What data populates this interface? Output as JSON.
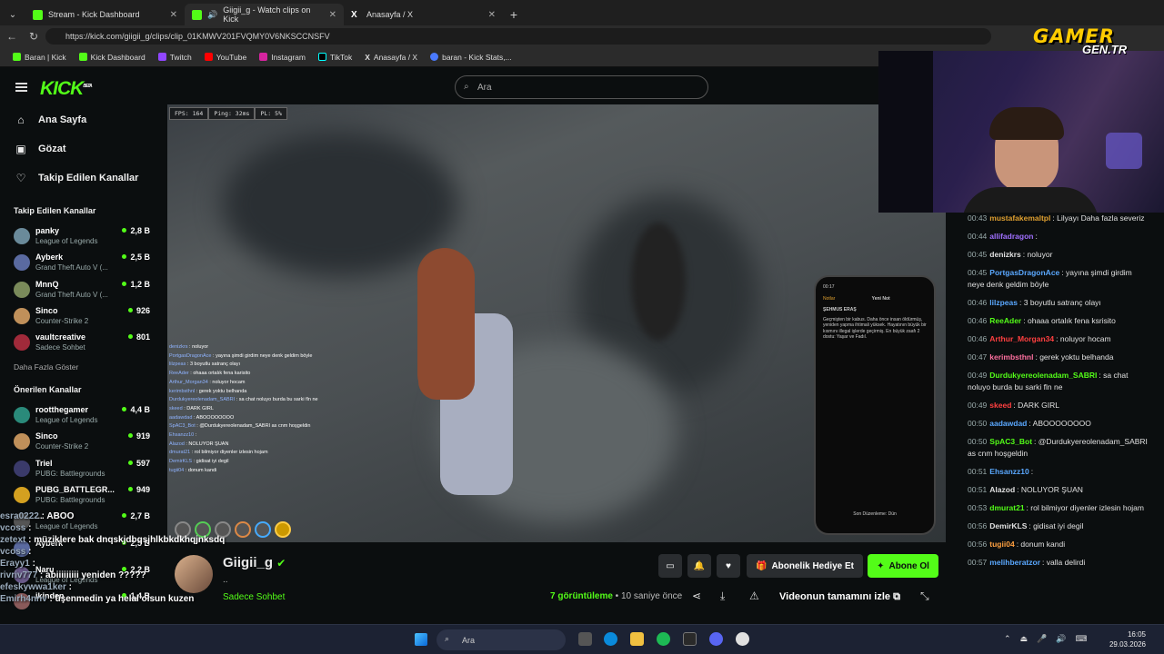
{
  "browser": {
    "tabs": [
      {
        "label": "Stream - Kick Dashboard",
        "color": "#53fc18"
      },
      {
        "label": "Giigii_g - Watch clips on Kick",
        "color": "#53fc18"
      },
      {
        "label": "Anasayfa / X",
        "color": "#ffffff"
      }
    ],
    "url": "https://kick.com/giigii_g/clips/clip_01KMWV201FVQMY0V6NKSCCNSFV",
    "bookmarks": [
      "Baran | Kick",
      "Kick Dashboard",
      "Twitch",
      "YouTube",
      "Instagram",
      "TikTok",
      "Anasayfa / X",
      "baran - Kick Stats,..."
    ]
  },
  "kick": {
    "logo": "KICK",
    "beta": "BETA",
    "nav": [
      "Ana Sayfa",
      "Gözat",
      "Takip Edilen Kanallar"
    ],
    "followed_title": "Takip Edilen Kanallar",
    "followed": [
      {
        "name": "panky",
        "game": "League of Legends",
        "viewers": "2,8 B",
        "color": "#6a8a9a"
      },
      {
        "name": "Ayberk",
        "game": "Grand Theft Auto V (...",
        "viewers": "2,5 B",
        "color": "#5a6aa0"
      },
      {
        "name": "MnnQ",
        "game": "Grand Theft Auto V (...",
        "viewers": "1,2 B",
        "color": "#7a8a5a"
      },
      {
        "name": "Sinco",
        "game": "Counter-Strike 2",
        "viewers": "926",
        "color": "#c0905a"
      },
      {
        "name": "vaultcreative",
        "game": "Sadece Sohbet",
        "viewers": "801",
        "color": "#a02a3a"
      }
    ],
    "show_more": "Daha Fazla Göster",
    "recommended_title": "Önerilen Kanallar",
    "recommended": [
      {
        "name": "rootthegamer",
        "game": "League of Legends",
        "viewers": "4,4 B",
        "color": "#2a8a7a"
      },
      {
        "name": "Sinco",
        "game": "Counter-Strike 2",
        "viewers": "919",
        "color": "#c0905a"
      },
      {
        "name": "Triel",
        "game": "PUBG: Battlegrounds",
        "viewers": "597",
        "color": "#3a3a6a"
      },
      {
        "name": "PUBG_BATTLEGR...",
        "game": "PUBG: Battlegrounds",
        "viewers": "949",
        "color": "#d4a020"
      },
      {
        "name": "...",
        "game": "League of Legends",
        "viewers": "2,7 B",
        "color": "#555"
      },
      {
        "name": "Ayberk",
        "game": "",
        "viewers": "2,5 B",
        "color": "#5a6aa0"
      },
      {
        "name": "Naru",
        "game": "League of Legends",
        "viewers": "2,2 B",
        "color": "#6a5a8a"
      },
      {
        "name": "ikinden",
        "game": "",
        "viewers": "1,4 B",
        "color": "#8a5a5a"
      }
    ],
    "search_placeholder": "Ara",
    "channel": {
      "name": "Giigii_g",
      "dots": "..",
      "category": "Sadece Sohbet",
      "views_count": "7",
      "views_label": "görüntüleme",
      "age": "10 saniye önce",
      "gift": "Abonelik Hediye Et",
      "subscribe": "Abone Ol",
      "full_video": "Videonun tamamını izle"
    }
  },
  "game": {
    "fps": "FPS: 164",
    "ping": "Ping: 32ms",
    "pl": "PL: 5%",
    "chat": [
      {
        "u": "denizkrs",
        "m": "noluyor"
      },
      {
        "u": "PortgasDragonAce",
        "m": "yayına şimdi girdim neye denk geldim böyle"
      },
      {
        "u": "lilzpeas",
        "m": "3 boyutlu satranç olayı"
      },
      {
        "u": "ReeAder",
        "m": "ohaaa ortalık fena karisito"
      },
      {
        "u": "Arthur_Morgan34",
        "m": "noluyor hocam"
      },
      {
        "u": "kerimbsthnl",
        "m": "gerek yoktu belhanda"
      },
      {
        "u": "Durdukyereolenadam_SABRI",
        "m": "sa chat noluyo burda bu sarki fln ne"
      },
      {
        "u": "skeed",
        "m": "DARK GIRL"
      },
      {
        "u": "aadawdad",
        "m": "ABOOOOOOOO"
      },
      {
        "u": "SpAC3_Bot",
        "m": "@Durdukyereolenadam_SABRI as cnm hoşgeldin"
      },
      {
        "u": "Ehsanzz10",
        "m": ""
      },
      {
        "u": "Alazod",
        "m": "NOLUYOR ŞUAN"
      },
      {
        "u": "dmurat21",
        "m": "rol bilmiyor diyenler izlesin hojam"
      },
      {
        "u": "DemirKLS",
        "m": "gidisat iyi degil"
      },
      {
        "u": "tugii04",
        "m": "donum kandi"
      }
    ],
    "phone": {
      "time": "00:17",
      "back": "Notlar",
      "title": "Yeni Not",
      "heading": "ŞEHMUS ERAŞ",
      "body": "Geçmişten bir kabus. Daha önce insan öldürmüş, yeniden yapma ihtimali yüksek. Hayatının büyük bir kısmını illegal işlerde geçirmiş. En büyük zaafı 2 dostu: Yaşar ve Fadıl.",
      "footer": "Son Düzenleme: Dün"
    }
  },
  "overlay_chat": [
    {
      "u": "esra0222",
      "m": "ABOO"
    },
    {
      "u": "vcoss",
      "m": ""
    },
    {
      "u": "zetext",
      "m": "müziklere bak dnqskjdbqsjhlkbkdkhqjnksdq"
    },
    {
      "u": "vcoss",
      "m": ""
    },
    {
      "u": "Erayy1",
      "m": ""
    },
    {
      "u": "rivriv777",
      "m": "abiiiiiiiii yeniden ?????"
    },
    {
      "u": "efeskywwa1ker",
      "m": ""
    },
    {
      "u": "Emirh4nnv",
      "m": "üşenmedin ya helal olsun kuzen"
    }
  ],
  "chat": [
    {
      "t": "00:43",
      "u": "mustafakemaltpl",
      "c": "#e0a030",
      "m": "Lilyayı Daha fazla severiz"
    },
    {
      "t": "00:44",
      "u": "allifadragon",
      "c": "#a070ff",
      "m": ""
    },
    {
      "t": "00:45",
      "u": "denizkrs",
      "c": "#e0e0e0",
      "m": "noluyor"
    },
    {
      "t": "00:45",
      "u": "PortgasDragonAce",
      "c": "#5aa8ff",
      "m": "yayına şimdi girdim neye denk geldim böyle"
    },
    {
      "t": "00:46",
      "u": "lilzpeas",
      "c": "#5aa8ff",
      "m": "3 boyutlu satranç olayı"
    },
    {
      "t": "00:46",
      "u": "ReeAder",
      "c": "#53fc18",
      "m": "ohaaa ortalık fena ksrisito"
    },
    {
      "t": "00:46",
      "u": "Arthur_Morgan34",
      "c": "#ff4040",
      "m": "noluyor hocam"
    },
    {
      "t": "00:47",
      "u": "kerimbsthnl",
      "c": "#ff70a0",
      "m": "gerek yoktu belhanda"
    },
    {
      "t": "00:49",
      "u": "Durdukyereolenadam_SABRI",
      "c": "#53fc18",
      "m": "sa chat noluyo burda bu sarki fln ne"
    },
    {
      "t": "00:49",
      "u": "skeed",
      "c": "#ff4040",
      "m": "DARK GIRL"
    },
    {
      "t": "00:50",
      "u": "aadawdad",
      "c": "#5aa8ff",
      "m": "ABOOOOOOOO"
    },
    {
      "t": "00:50",
      "u": "SpAC3_Bot",
      "c": "#53fc18",
      "m": "@Durdukyereolenadam_SABRI as cnm hoşgeldin"
    },
    {
      "t": "00:51",
      "u": "Ehsanzz10",
      "c": "#5aa8ff",
      "m": ""
    },
    {
      "t": "00:51",
      "u": "Alazod",
      "c": "#e0e0e0",
      "m": "NOLUYOR ŞUAN"
    },
    {
      "t": "00:53",
      "u": "dmurat21",
      "c": "#53fc18",
      "m": "rol bilmiyor diyenler izlesin hojam"
    },
    {
      "t": "00:56",
      "u": "DemirKLS",
      "c": "#e0e0e0",
      "m": "gidisat iyi degil"
    },
    {
      "t": "00:56",
      "u": "tugii04",
      "c": "#ffa040",
      "m": "donum kandi"
    },
    {
      "t": "00:57",
      "u": "melihberatzor",
      "c": "#5aa8ff",
      "m": "valla delirdi"
    }
  ],
  "watermark": {
    "line1": "GAMER",
    "line2": "GEN.TR"
  },
  "taskbar": {
    "search": "Ara",
    "time": "16:05",
    "date": "29.03.2026"
  }
}
